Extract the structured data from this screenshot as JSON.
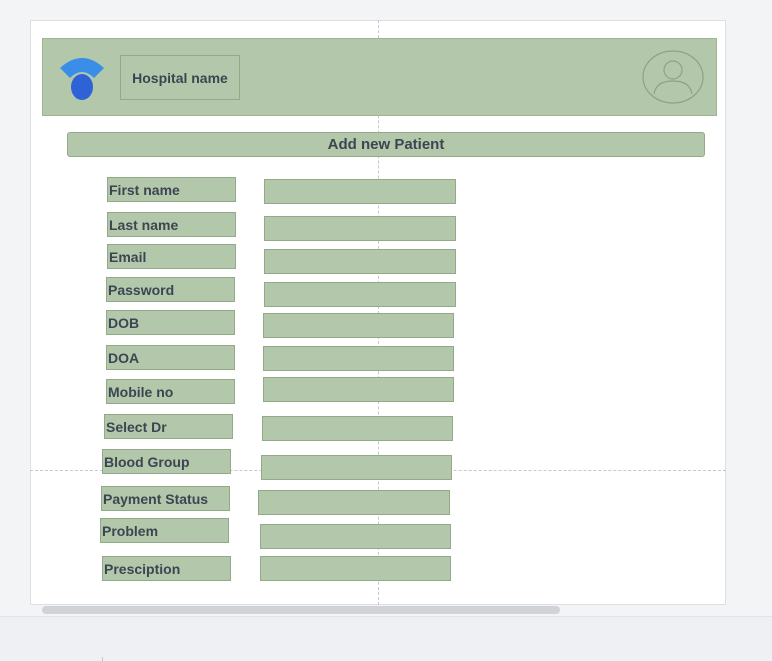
{
  "header": {
    "hospital_name": "Hospital name",
    "logo_icon": "hospital-logo-icon",
    "avatar_icon": "user-avatar-icon",
    "color": "#b3c8aa"
  },
  "form": {
    "title": "Add new Patient",
    "fields": [
      {
        "label": "First name"
      },
      {
        "label": "Last name"
      },
      {
        "label": "Email"
      },
      {
        "label": "Password"
      },
      {
        "label": "DOB"
      },
      {
        "label": "DOA"
      },
      {
        "label": "Mobile no"
      },
      {
        "label": "Select Dr"
      },
      {
        "label": "Blood Group"
      },
      {
        "label": "Payment Status"
      },
      {
        "label": "Problem"
      },
      {
        "label": "Presciption"
      }
    ]
  },
  "colors": {
    "accent": "#b3c8aa",
    "logo_blue": "#2b6fe0",
    "text": "#3c4552"
  }
}
